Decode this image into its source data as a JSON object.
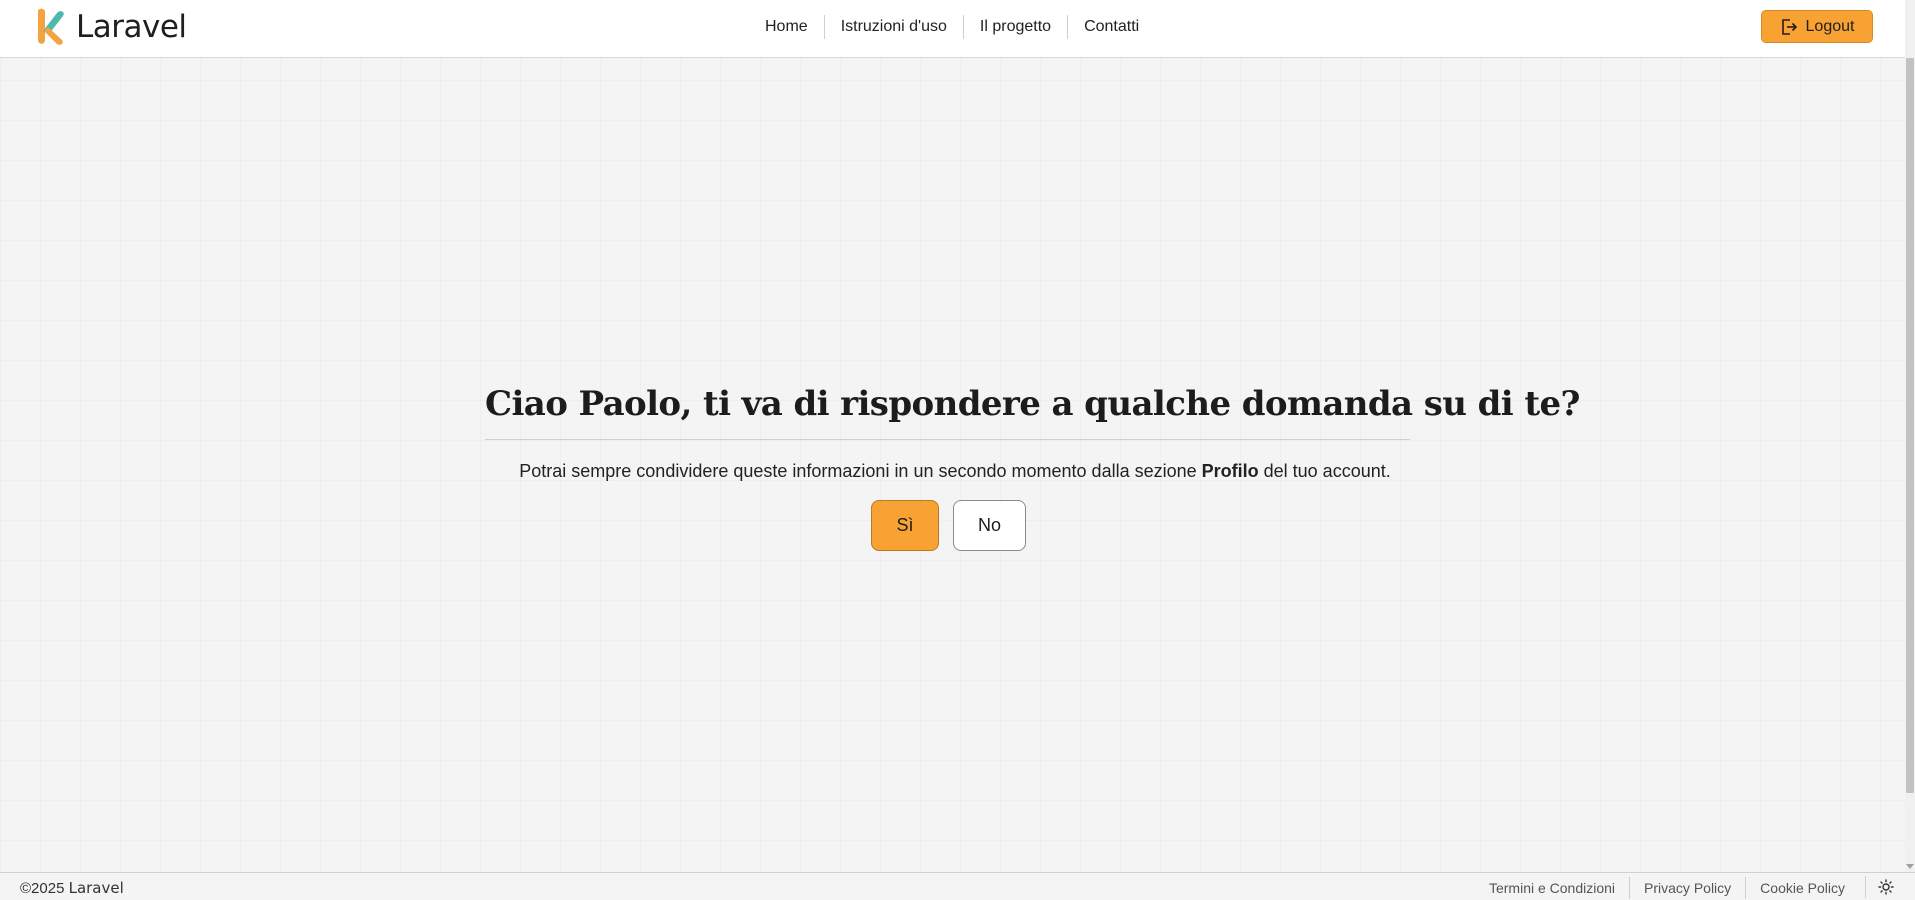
{
  "header": {
    "brand_name": "Laravel",
    "nav": [
      {
        "label": "Home"
      },
      {
        "label": "Istruzioni d'uso"
      },
      {
        "label": "Il progetto"
      },
      {
        "label": "Contatti"
      }
    ],
    "logout_label": "Logout"
  },
  "main": {
    "question_prefix": "Ciao ",
    "user_name": "Paolo",
    "question_suffix": ", ti va di rispondere a qualche domanda su di te?",
    "info_prefix": "Potrai sempre condividere queste informazioni in un secondo momento dalla sezione ",
    "info_section": "Profilo",
    "info_suffix": " del tuo account.",
    "yes_label": "Sì",
    "no_label": "No"
  },
  "footer": {
    "copyright_prefix": "©2025 ",
    "copyright_brand": "Laravel",
    "links": [
      {
        "label": "Termini e Condizioni"
      },
      {
        "label": "Privacy Policy"
      },
      {
        "label": "Cookie Policy"
      }
    ]
  },
  "icons": {
    "brand": "laravel-logo-icon",
    "logout": "logout-icon",
    "theme": "sun-icon"
  },
  "colors": {
    "accent": "#f7a233",
    "logo_orange": "#f4a340",
    "logo_teal": "#4cb8b0"
  }
}
